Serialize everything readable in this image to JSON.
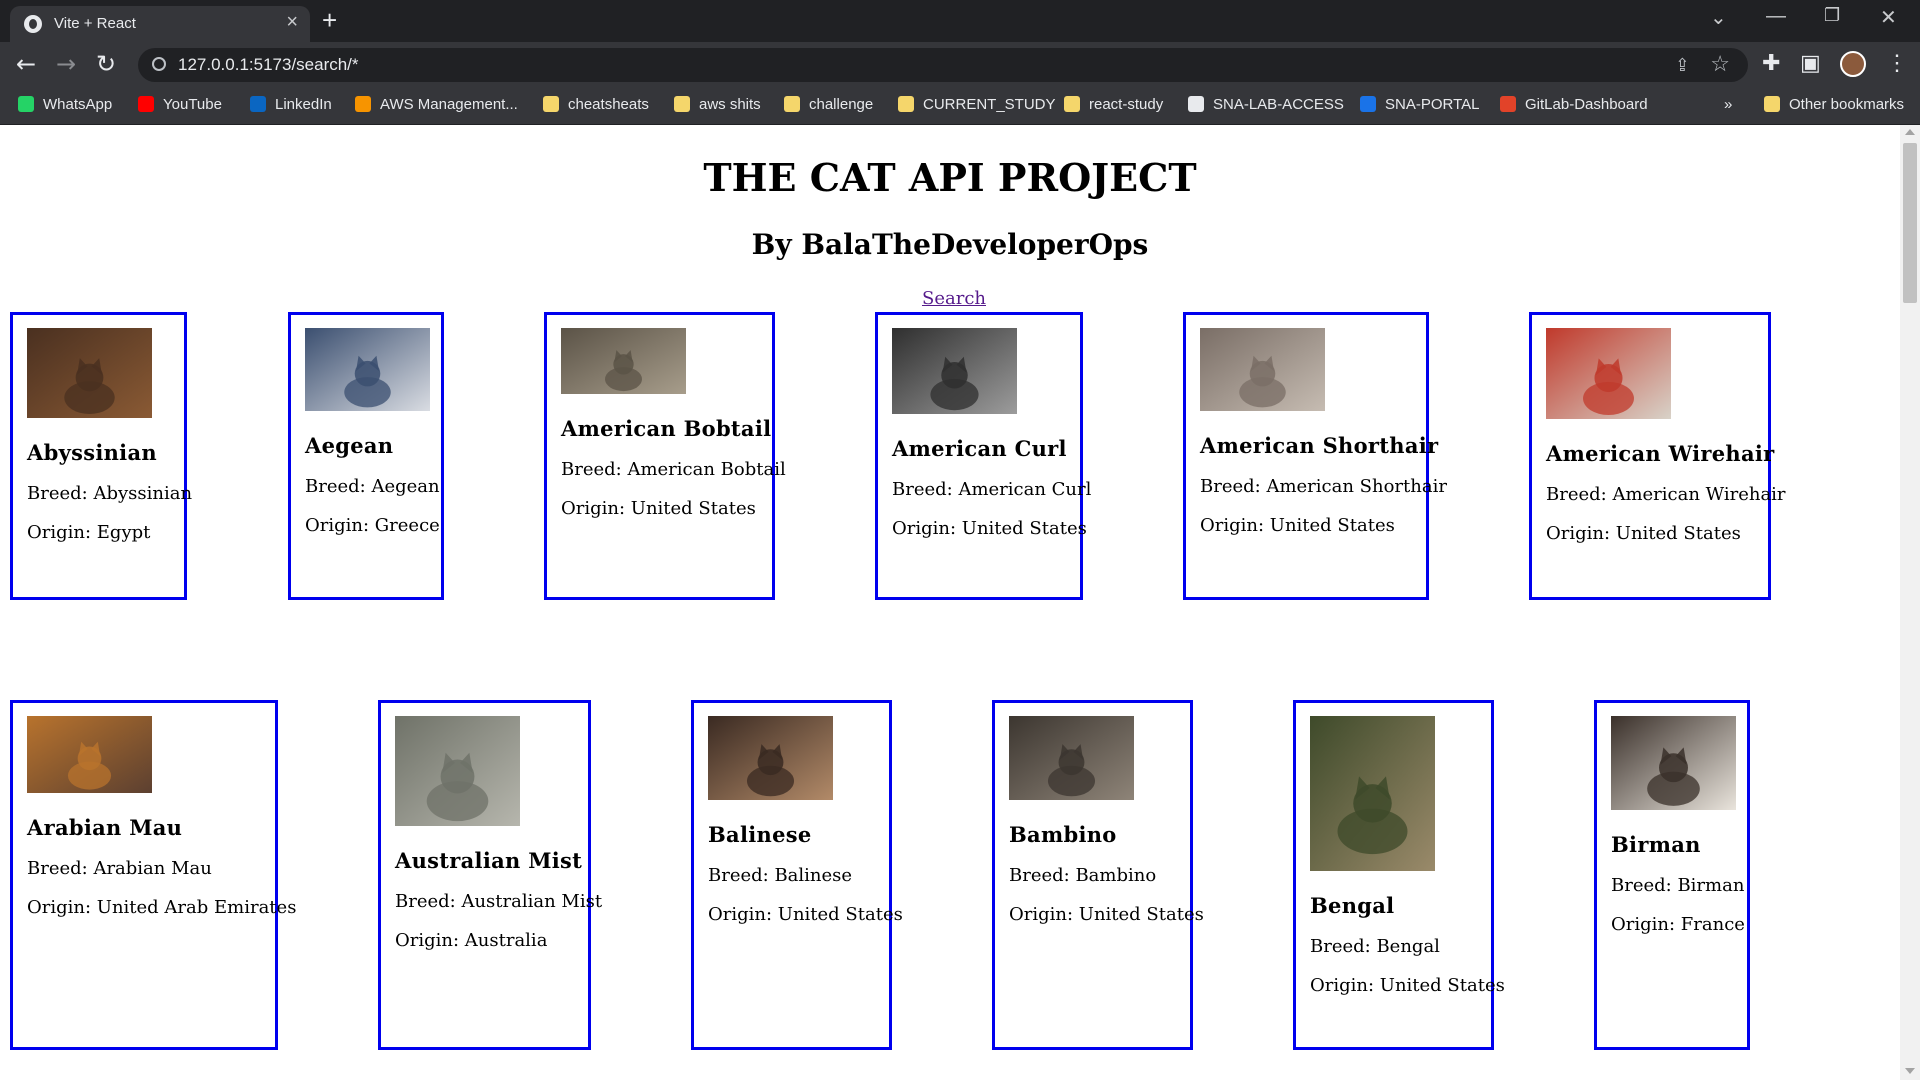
{
  "browser": {
    "tab_title": "Vite + React",
    "url": "127.0.0.1:5173/search/*",
    "bookmarks": [
      {
        "label": "WhatsApp",
        "icon": "whatsapp-icon",
        "color": "#25d366"
      },
      {
        "label": "YouTube",
        "icon": "youtube-icon",
        "color": "#ff0000"
      },
      {
        "label": "LinkedIn",
        "icon": "linkedin-icon",
        "color": "#0a66c2"
      },
      {
        "label": "AWS Management...",
        "icon": "aws-icon",
        "color": "#f79400"
      },
      {
        "label": "cheatsheats",
        "icon": "folder-icon",
        "color": "#f5d66b"
      },
      {
        "label": "aws shits",
        "icon": "folder-icon",
        "color": "#f5d66b"
      },
      {
        "label": "challenge",
        "icon": "folder-icon",
        "color": "#f5d66b"
      },
      {
        "label": "CURRENT_STUDY",
        "icon": "folder-icon",
        "color": "#f5d66b"
      },
      {
        "label": "react-study",
        "icon": "folder-icon",
        "color": "#f5d66b"
      },
      {
        "label": "SNA-LAB-ACCESS",
        "icon": "site-icon",
        "color": "#e8eaed"
      },
      {
        "label": "SNA-PORTAL",
        "icon": "portal-icon",
        "color": "#1a73e8"
      },
      {
        "label": "GitLab-Dashboard",
        "icon": "gitlab-icon",
        "color": "#e24329"
      }
    ],
    "overflow": "»",
    "other_bookmarks": "Other bookmarks"
  },
  "page": {
    "title": "THE CAT API PROJECT",
    "subtitle": "By BalaTheDeveloperOps",
    "search_link": "Search"
  },
  "cats": [
    {
      "name": "Abyssinian",
      "breed": "Breed: Abyssinian",
      "origin": "Origin: Egypt",
      "colors": [
        "#4a3020",
        "#8a5a34"
      ]
    },
    {
      "name": "Aegean",
      "breed": "Breed: Aegean",
      "origin": "Origin: Greece",
      "colors": [
        "#3b4f70",
        "#d9dce2"
      ]
    },
    {
      "name": "American Bobtail",
      "breed": "Breed: American Bobtail",
      "origin": "Origin: United States",
      "colors": [
        "#5b5347",
        "#a79d8b"
      ]
    },
    {
      "name": "American Curl",
      "breed": "Breed: American Curl",
      "origin": "Origin: United States",
      "colors": [
        "#2f2f2f",
        "#9c9c9c"
      ]
    },
    {
      "name": "American Shorthair",
      "breed": "Breed: American Shorthair",
      "origin": "Origin: United States",
      "colors": [
        "#7a6e66",
        "#c6bcb2"
      ]
    },
    {
      "name": "American Wirehair",
      "breed": "Breed: American Wirehair",
      "origin": "Origin: United States",
      "colors": [
        "#c0392b",
        "#d8d2c8"
      ]
    },
    {
      "name": "Arabian Mau",
      "breed": "Breed: Arabian Mau",
      "origin": "Origin: United Arab Emirates",
      "colors": [
        "#b8732d",
        "#5c4030"
      ]
    },
    {
      "name": "Australian Mist",
      "breed": "Breed: Australian Mist",
      "origin": "Origin: Australia",
      "colors": [
        "#6f7268",
        "#b6b6ad"
      ]
    },
    {
      "name": "Balinese",
      "breed": "Breed: Balinese",
      "origin": "Origin: United States",
      "colors": [
        "#3a2a22",
        "#b28a68"
      ]
    },
    {
      "name": "Bambino",
      "breed": "Breed: Bambino",
      "origin": "Origin: United States",
      "colors": [
        "#3c3630",
        "#8e8478"
      ]
    },
    {
      "name": "Bengal",
      "breed": "Breed: Bengal",
      "origin": "Origin: United States",
      "colors": [
        "#3e4a2a",
        "#9a8a6a"
      ]
    },
    {
      "name": "Birman",
      "breed": "Breed: Birman",
      "origin": "Origin: France",
      "colors": [
        "#3a302a",
        "#e9e4dc"
      ]
    }
  ]
}
